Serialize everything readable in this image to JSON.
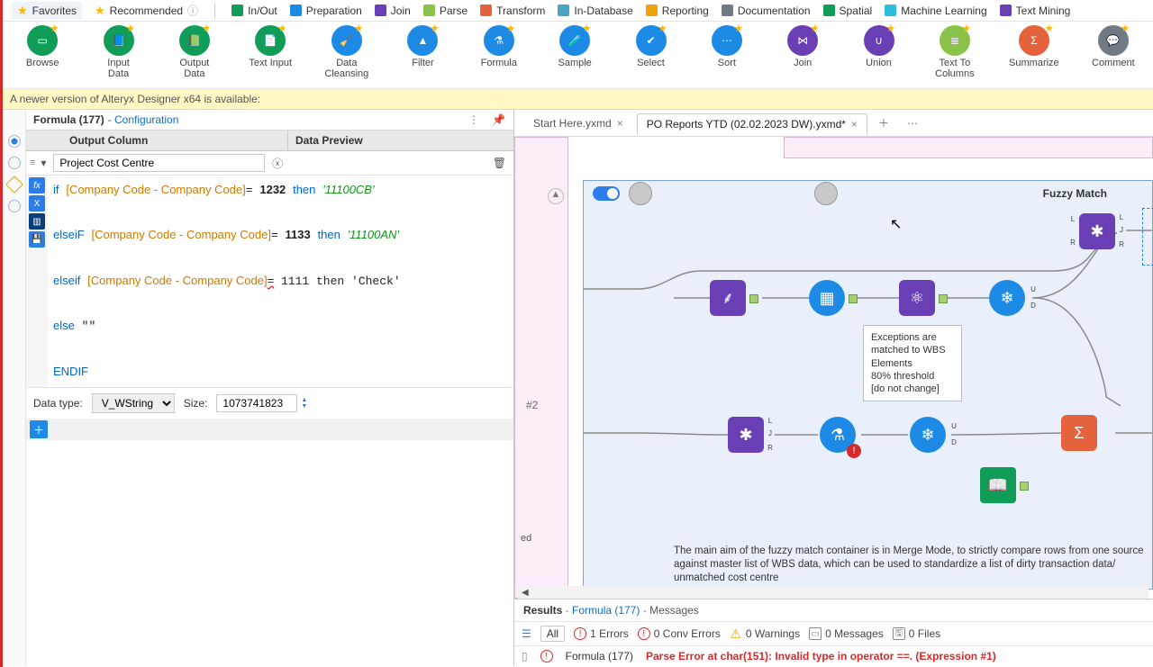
{
  "categories": [
    {
      "label": "Favorites",
      "color": "#ffb400",
      "star": true,
      "active": true
    },
    {
      "label": "Recommended",
      "color": "#ffb400",
      "star": true,
      "info": true
    },
    {
      "label": "In/Out",
      "color": "#0f9d58"
    },
    {
      "label": "Preparation",
      "color": "#1d8ae6"
    },
    {
      "label": "Join",
      "color": "#6a3fb5"
    },
    {
      "label": "Parse",
      "color": "#8bc34a"
    },
    {
      "label": "Transform",
      "color": "#e5633c"
    },
    {
      "label": "In-Database",
      "color": "#4aa3c4"
    },
    {
      "label": "Reporting",
      "color": "#f0a30a"
    },
    {
      "label": "Documentation",
      "color": "#6f7a85"
    },
    {
      "label": "Spatial",
      "color": "#0f9d58"
    },
    {
      "label": "Machine Learning",
      "color": "#2ac0d9"
    },
    {
      "label": "Text Mining",
      "color": "#6a3fb5"
    }
  ],
  "tools": [
    {
      "label": "Browse",
      "color": "#0f9d58"
    },
    {
      "label": "Input Data",
      "color": "#0f9d58"
    },
    {
      "label": "Output Data",
      "color": "#0f9d58"
    },
    {
      "label": "Text Input",
      "color": "#0f9d58"
    },
    {
      "label": "Data Cleansing",
      "color": "#1d8ae6"
    },
    {
      "label": "Filter",
      "color": "#1d8ae6"
    },
    {
      "label": "Formula",
      "color": "#1d8ae6"
    },
    {
      "label": "Sample",
      "color": "#1d8ae6"
    },
    {
      "label": "Select",
      "color": "#1d8ae6"
    },
    {
      "label": "Sort",
      "color": "#1d8ae6"
    },
    {
      "label": "Join",
      "color": "#6a3fb5"
    },
    {
      "label": "Union",
      "color": "#6a3fb5"
    },
    {
      "label": "Text To Columns",
      "color": "#8bc34a"
    },
    {
      "label": "Summarize",
      "color": "#e5633c"
    },
    {
      "label": "Comment",
      "color": "#6f7a85"
    }
  ],
  "banner": "A newer version of Alteryx Designer x64 is available:",
  "config": {
    "title": "Formula (177)",
    "subtitle": "- Configuration",
    "col_output": "Output Column",
    "col_preview": "Data Preview",
    "output_field": "Project Cost Centre",
    "code_plain": "if [Company Code - Company Code]= 1232 then '11100CB'\n\nelseiF [Company Code - Company Code]= 1133 then '11100AN'\n\nelseif [Company Code - Company Code]= 1111 then 'Check'\n\nelse \"\"\n\nENDIF",
    "datatype_label": "Data type:",
    "datatype_value": "V_WString",
    "size_label": "Size:",
    "size_value": "1073741823"
  },
  "tabs": {
    "t1": "Start Here.yxmd",
    "t2": "PO Reports YTD (02.02.2023 DW).yxmd*"
  },
  "container": {
    "title": "Fuzzy Match",
    "annot": "Exceptions are matched to WBS Elements\n80% threshold\n[do not change]",
    "caption": "The main aim of the fuzzy match container is in Merge Mode, to strictly compare rows from one source against master list of WBS data, which can be used to standardize a list of dirty transaction data/ unmatched cost centre",
    "hash": "#2",
    "truncated": "ed"
  },
  "results": {
    "head_tool": "Results",
    "head_link": "Formula (177)",
    "head_tab": "Messages",
    "filter_all": "All",
    "filter_err": "1 Errors",
    "filter_conv": "0 Conv Errors",
    "filter_warn": "0 Warnings",
    "filter_msg": "0 Messages",
    "filter_files": "0 Files",
    "row_tool": "Formula (177)",
    "row_msg": "Parse Error at char(151): Invalid type in operator ==. (Expression #1)"
  }
}
